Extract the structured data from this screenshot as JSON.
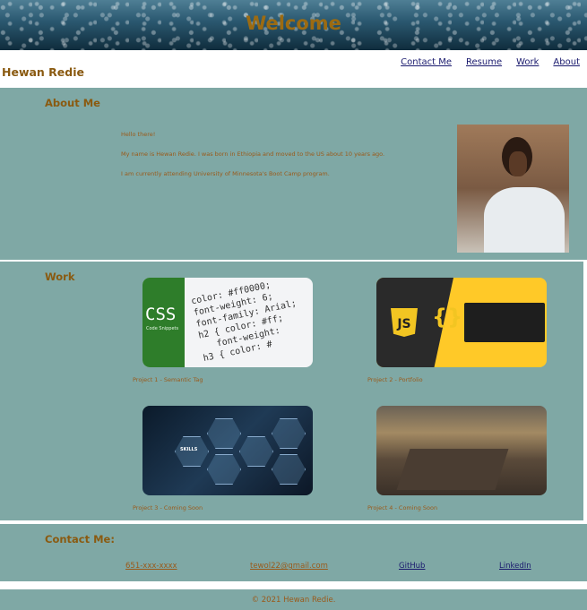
{
  "header": {
    "title": "Welcome"
  },
  "site_name": "Hewan Redie",
  "nav": {
    "contact": "Contact Me",
    "resume": "Resume",
    "work": "Work",
    "about": "About"
  },
  "about": {
    "title": "About Me",
    "paragraphs": [
      "Hello there!",
      "My name is Hewan Redie. I was born in Ethiopia and moved to the US about 10 years ago.",
      "I am currently attending University of Minnesota's Boot Camp program."
    ]
  },
  "work": {
    "title": "Work",
    "projects": [
      {
        "caption": "Project 1 - Semantic Tag"
      },
      {
        "caption": "Project 2 - Portfolio"
      },
      {
        "caption": "Project 3 - Coming Soon"
      },
      {
        "caption": "Project 4 - Coming Soon"
      }
    ],
    "image_text": {
      "css": "CSS",
      "code_snippets": "Code Snippets",
      "js": "JS",
      "brace": "{}",
      "skills": "SKILLS"
    }
  },
  "contact": {
    "title": "Contact Me:",
    "phone": "651-xxx-xxxx",
    "email": "tewol22@gmail.com",
    "github": "GitHub",
    "linkedin": "LinkedIn"
  },
  "footer": {
    "text": "© 2021 Hewan Redie."
  },
  "colors": {
    "section_bg": "#7fa8a5",
    "accent": "#8a5a10",
    "text": "#9a5a1a",
    "link": "#1a1a6e"
  }
}
